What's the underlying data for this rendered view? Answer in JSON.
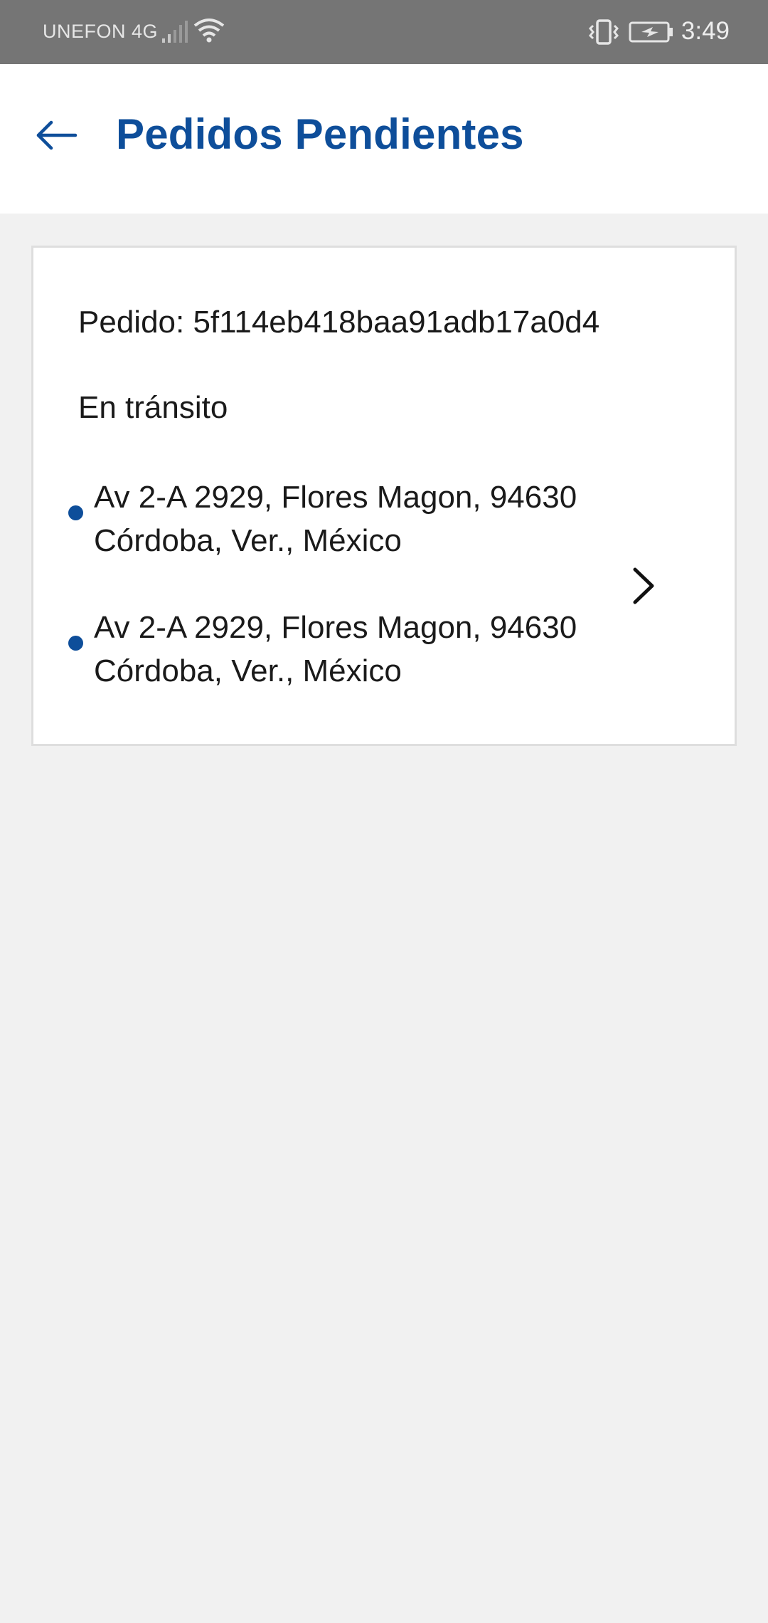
{
  "status_bar": {
    "carrier": "UNEFON 4G",
    "time": "3:49",
    "icons": [
      "signal-icon",
      "wifi-icon",
      "vibrate-icon",
      "battery-charging-icon"
    ]
  },
  "header": {
    "title": "Pedidos Pendientes",
    "back_icon": "arrow-left-icon",
    "accent_color": "#0e4e9a"
  },
  "orders": [
    {
      "id_label": "Pedido: 5f114eb418baa91adb17a0d4",
      "status": "En tránsito",
      "addresses": [
        {
          "line1": "Av 2-A 2929, Flores Magon, 94630",
          "line2": "Córdoba, Ver., México"
        },
        {
          "line1": "Av 2-A 2929, Flores Magon, 94630",
          "line2": "Córdoba, Ver., México"
        }
      ],
      "chevron_icon": "chevron-right-icon"
    }
  ]
}
